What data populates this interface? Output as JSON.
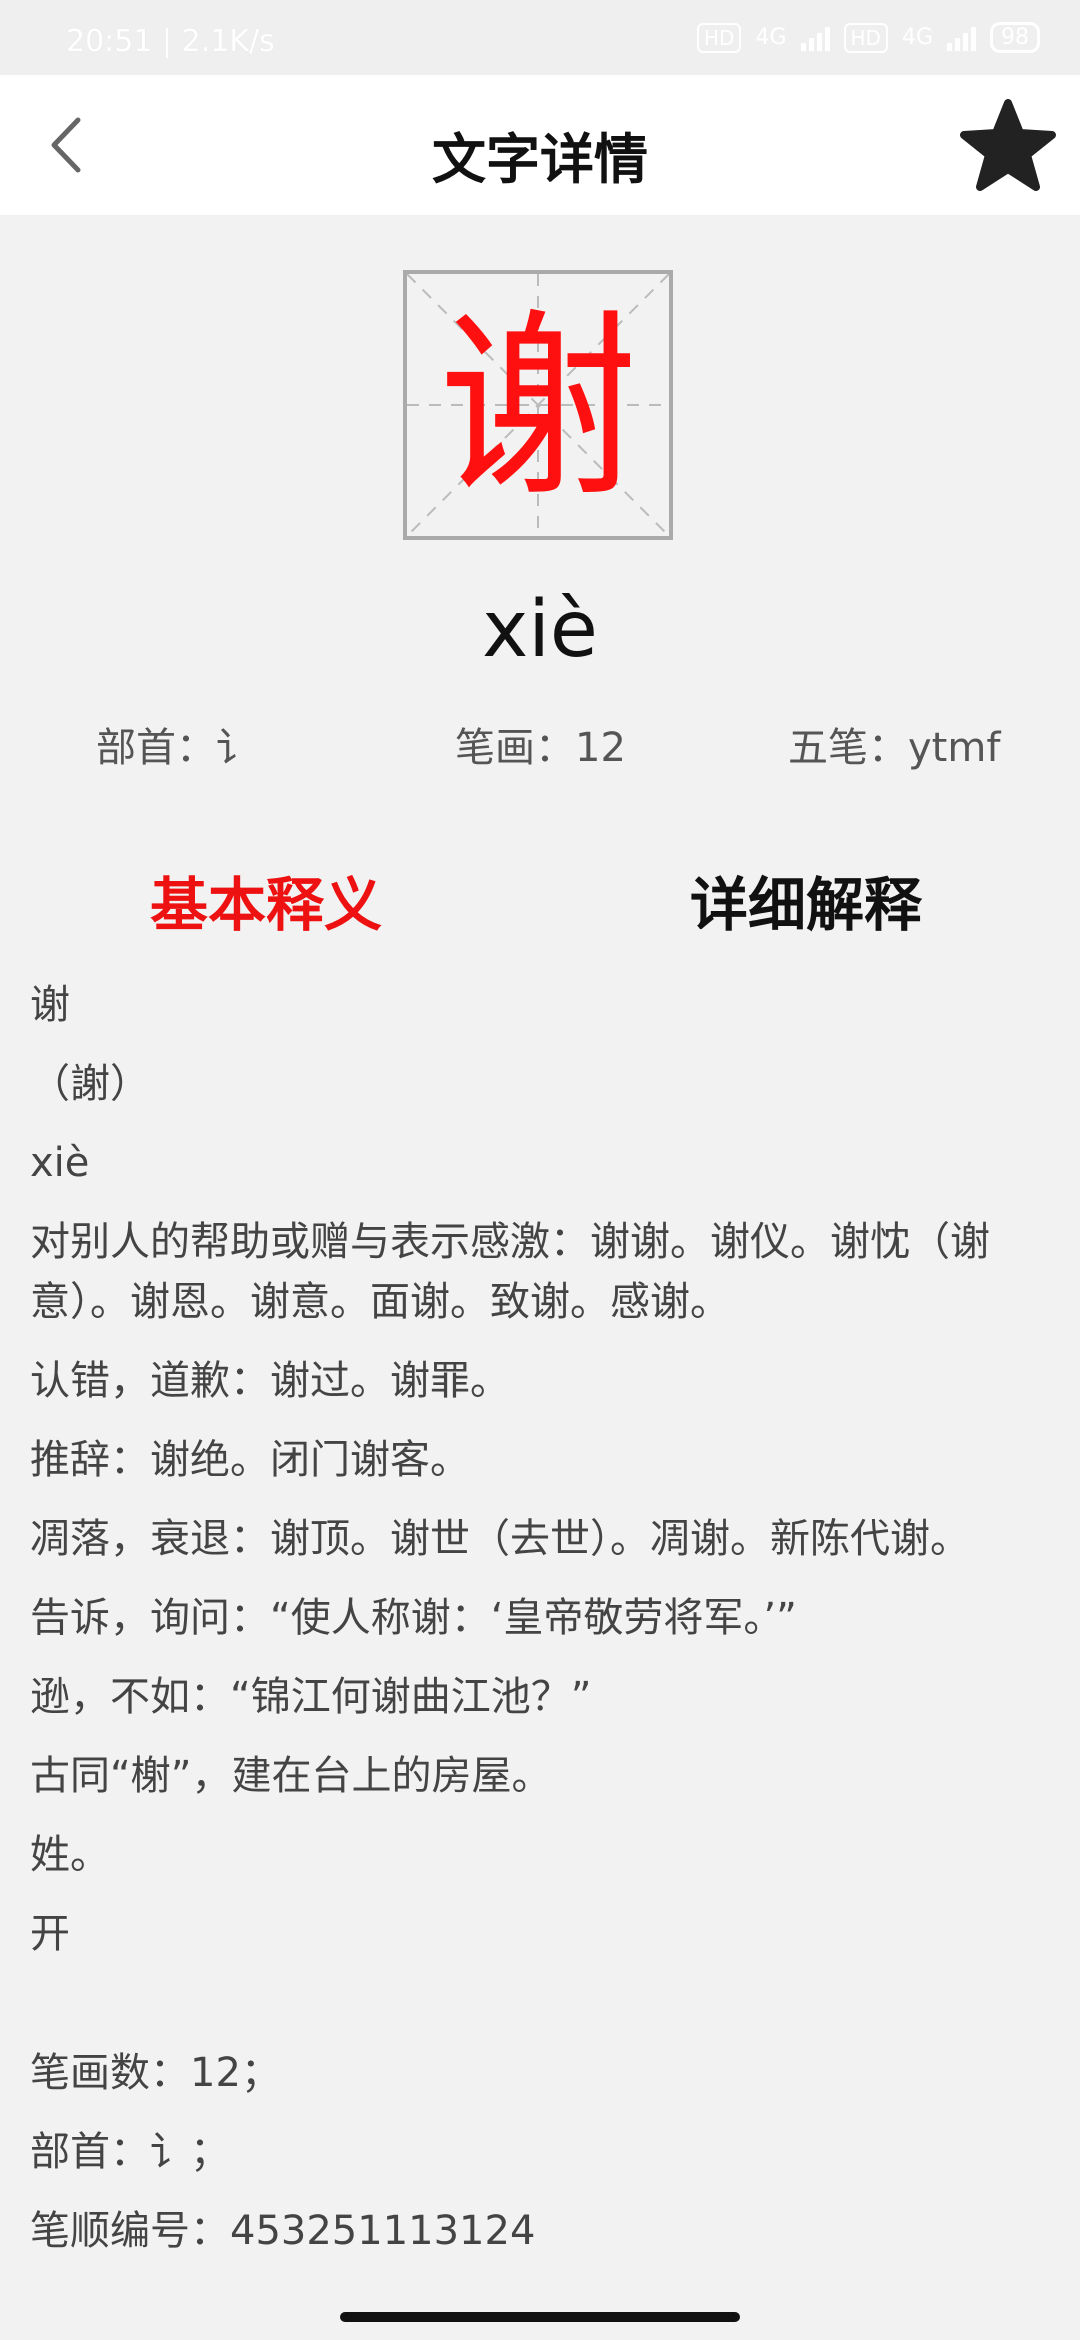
{
  "status": {
    "time": "20:51 | 2.1K/s",
    "hd1": "HD",
    "net1": "4G",
    "hd2": "HD",
    "net2": "4G",
    "battery": "98"
  },
  "header": {
    "title": "文字详情"
  },
  "character": {
    "glyph": "谢",
    "pinyin": "xiè",
    "radical": "部首：讠",
    "strokes": "笔画：12",
    "wubi": "五笔：ytmf"
  },
  "tabs": {
    "basic": "基本释义",
    "detail": "详细解释"
  },
  "definition": {
    "lines": [
      "谢",
      "（謝）",
      "xiè",
      "对别人的帮助或赠与表示感激：谢谢。谢仪。谢忱（谢意）。谢恩。谢意。面谢。致谢。感谢。",
      "认错，道歉：谢过。谢罪。",
      "推辞：谢绝。闭门谢客。",
      "凋落，衰退：谢顶。谢世（去世）。凋谢。新陈代谢。",
      "告诉，询问：“使人称谢：‘皇帝敬劳将军。’”",
      "逊，不如：“锦江何谢曲江池？”",
      "古同“榭”，建在台上的房屋。",
      "姓。",
      "开"
    ],
    "footer": [
      "笔画数：12；",
      "部首：讠；",
      "笔顺编号：453251113124"
    ]
  }
}
